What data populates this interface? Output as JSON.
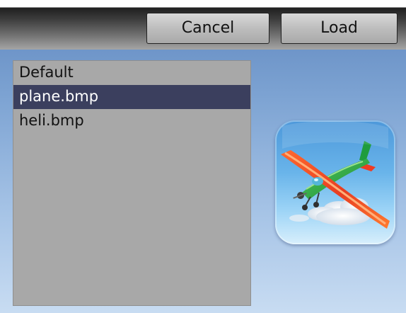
{
  "toolbar": {
    "cancel_label": "Cancel",
    "load_label": "Load"
  },
  "file_list": {
    "items": [
      {
        "label": "Default",
        "selected": false
      },
      {
        "label": "plane.bmp",
        "selected": true
      },
      {
        "label": "heli.bmp",
        "selected": false
      }
    ]
  },
  "preview": {
    "icon": "airplane-icon"
  },
  "colors": {
    "selected_row": "#3b3f5e",
    "list_background": "#a8a8a8",
    "toolbar_button": "#bdbdbd"
  }
}
